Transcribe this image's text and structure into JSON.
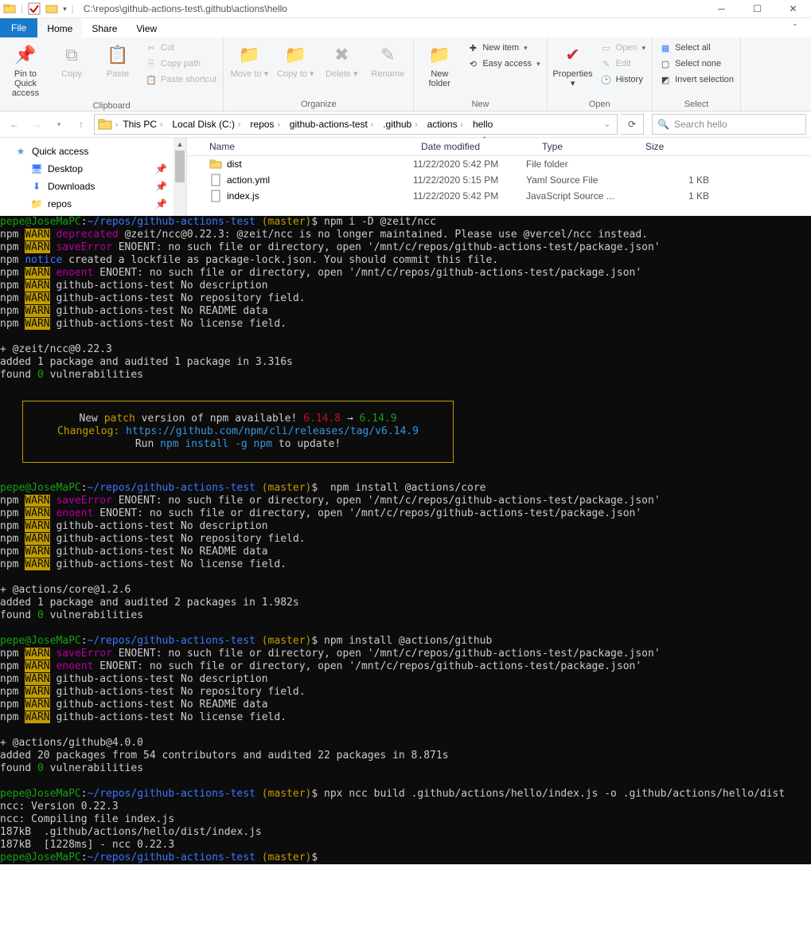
{
  "window": {
    "title_path": "C:\\repos\\github-actions-test\\.github\\actions\\hello",
    "menus": {
      "file": "File",
      "home": "Home",
      "share": "Share",
      "view": "View"
    }
  },
  "ribbon": {
    "clipboard": {
      "label": "Clipboard",
      "pin": "Pin to Quick access",
      "copy": "Copy",
      "paste": "Paste",
      "cut": "Cut",
      "copy_path": "Copy path",
      "paste_shortcut": "Paste shortcut"
    },
    "organize": {
      "label": "Organize",
      "move_to": "Move to",
      "copy_to": "Copy to",
      "delete": "Delete",
      "rename": "Rename"
    },
    "new": {
      "label": "New",
      "new_folder": "New folder",
      "new_item": "New item",
      "easy_access": "Easy access"
    },
    "open": {
      "label": "Open",
      "properties": "Properties",
      "open": "Open",
      "edit": "Edit",
      "history": "History"
    },
    "select": {
      "label": "Select",
      "select_all": "Select all",
      "select_none": "Select none",
      "invert": "Invert selection"
    }
  },
  "breadcrumbs": [
    "This PC",
    "Local Disk (C:)",
    "repos",
    "github-actions-test",
    ".github",
    "actions",
    "hello"
  ],
  "search_placeholder": "Search hello",
  "sidebar": {
    "quick_access": "Quick access",
    "items": [
      {
        "label": "Desktop",
        "icon": "desktop-icon"
      },
      {
        "label": "Downloads",
        "icon": "downloads-icon"
      },
      {
        "label": "repos",
        "icon": "folder-icon"
      }
    ]
  },
  "columns": {
    "name": "Name",
    "date": "Date modified",
    "type": "Type",
    "size": "Size"
  },
  "files": [
    {
      "name": "dist",
      "date": "11/22/2020 5:42 PM",
      "type": "File folder",
      "size": "",
      "icon": "folder"
    },
    {
      "name": "action.yml",
      "date": "11/22/2020 5:15 PM",
      "type": "Yaml Source File",
      "size": "1 KB",
      "icon": "file"
    },
    {
      "name": "index.js",
      "date": "11/22/2020 5:42 PM",
      "type": "JavaScript Source ...",
      "size": "1 KB",
      "icon": "file"
    }
  ],
  "terminal": {
    "prompt_user": "pepe@JoseMaPC",
    "prompt_path": "~/repos/github-actions-test",
    "prompt_branch": "(master)",
    "cmd1": "npm i -D @zeit/ncc",
    "warn": "WARN",
    "npm": "npm",
    "deprecated": "deprecated",
    "dep_msg": "@zeit/ncc@0.22.3: @zeit/ncc is no longer maintained. Please use @vercel/ncc instead.",
    "saveError": "saveError",
    "enoent_msg": "ENOENT: no such file or directory, open '/mnt/c/repos/github-actions-test/package.json'",
    "notice": "notice",
    "notice_msg": "created a lockfile as package-lock.json. You should commit this file.",
    "enoent": "enoent",
    "nodesc": "github-actions-test No description",
    "norepo": "github-actions-test No repository field.",
    "noreadme": "github-actions-test No README data",
    "nolic": "github-actions-test No license field.",
    "pkg1": "+ @zeit/ncc@0.22.3",
    "added1": "added 1 package and audited 1 package in 3.316s",
    "found": "found ",
    "zero": "0",
    "vuln": " vulnerabilities",
    "box_new": "New ",
    "box_patch": "patch",
    "box_avail": " version of npm available! ",
    "box_old": "6.14.8",
    "box_arrow": " → ",
    "box_newv": "6.14.9",
    "box_changelog": "Changelog: ",
    "box_url": "https://github.com/npm/cli/releases/tag/v6.14.9",
    "box_run": "Run ",
    "box_cmd": "npm install -g npm",
    "box_update": " to update!",
    "cmd2": " npm install @actions/core",
    "pkg2": "+ @actions/core@1.2.6",
    "added2": "added 1 package and audited 2 packages in 1.982s",
    "cmd3": "npm install @actions/github",
    "pkg3": "+ @actions/github@4.0.0",
    "added3": "added 20 packages from 54 contributors and audited 22 packages in 8.871s",
    "cmd4": "npx ncc build .github/actions/hello/index.js -o .github/actions/hello/dist",
    "ncc1": "ncc: Version 0.22.3",
    "ncc2": "ncc: Compiling file index.js",
    "ncc3": "187kB  .github/actions/hello/dist/index.js",
    "ncc4": "187kB  [1228ms] - ncc 0.22.3"
  }
}
